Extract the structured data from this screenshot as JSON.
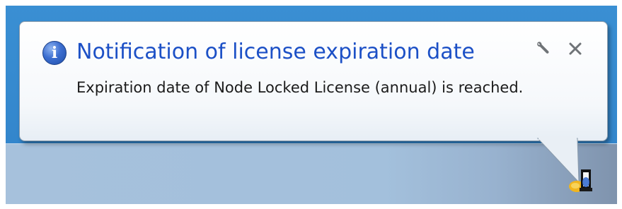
{
  "notification": {
    "title": "Notification of license expiration date",
    "message": "Expiration date of Node Locked License (annual) is reached."
  },
  "icons": {
    "info": "info-icon",
    "options": "wrench-icon",
    "close": "close-icon",
    "tray": "app-tray-icon"
  },
  "colors": {
    "title": "#1c50c6",
    "desktop": "#3386cc",
    "taskbar": "#a3c0dc"
  }
}
